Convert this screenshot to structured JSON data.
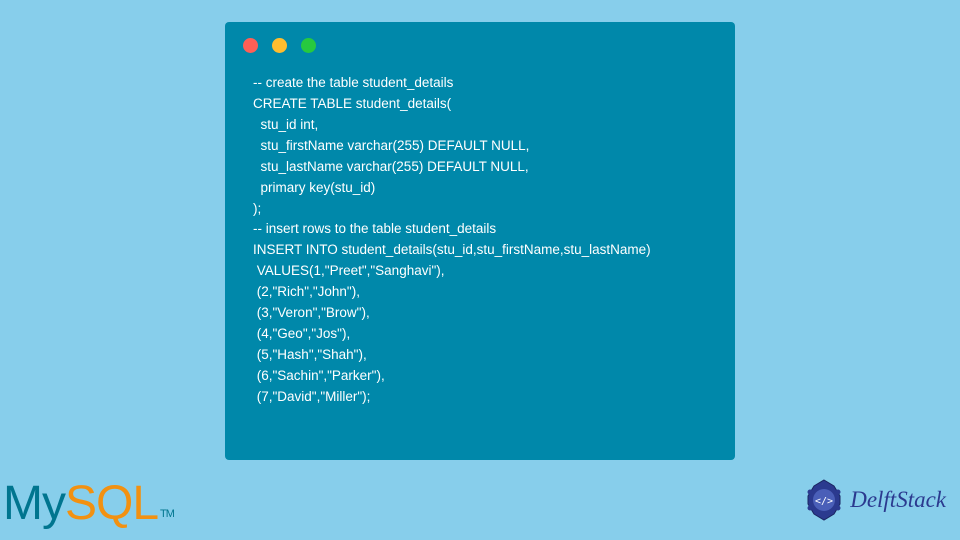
{
  "code": {
    "lines": [
      "-- create the table student_details",
      "CREATE TABLE student_details(",
      "  stu_id int,",
      "  stu_firstName varchar(255) DEFAULT NULL,",
      "  stu_lastName varchar(255) DEFAULT NULL,",
      "  primary key(stu_id)",
      ");",
      "-- insert rows to the table student_details",
      "INSERT INTO student_details(stu_id,stu_firstName,stu_lastName)",
      " VALUES(1,\"Preet\",\"Sanghavi\"),",
      " (2,\"Rich\",\"John\"),",
      " (3,\"Veron\",\"Brow\"),",
      " (4,\"Geo\",\"Jos\"),",
      " (5,\"Hash\",\"Shah\"),",
      " (6,\"Sachin\",\"Parker\"),",
      " (7,\"David\",\"Miller\");"
    ]
  },
  "logos": {
    "mysql_my": "My",
    "mysql_sql": "SQL",
    "mysql_tm": "TM",
    "delft": "DelftStack"
  }
}
